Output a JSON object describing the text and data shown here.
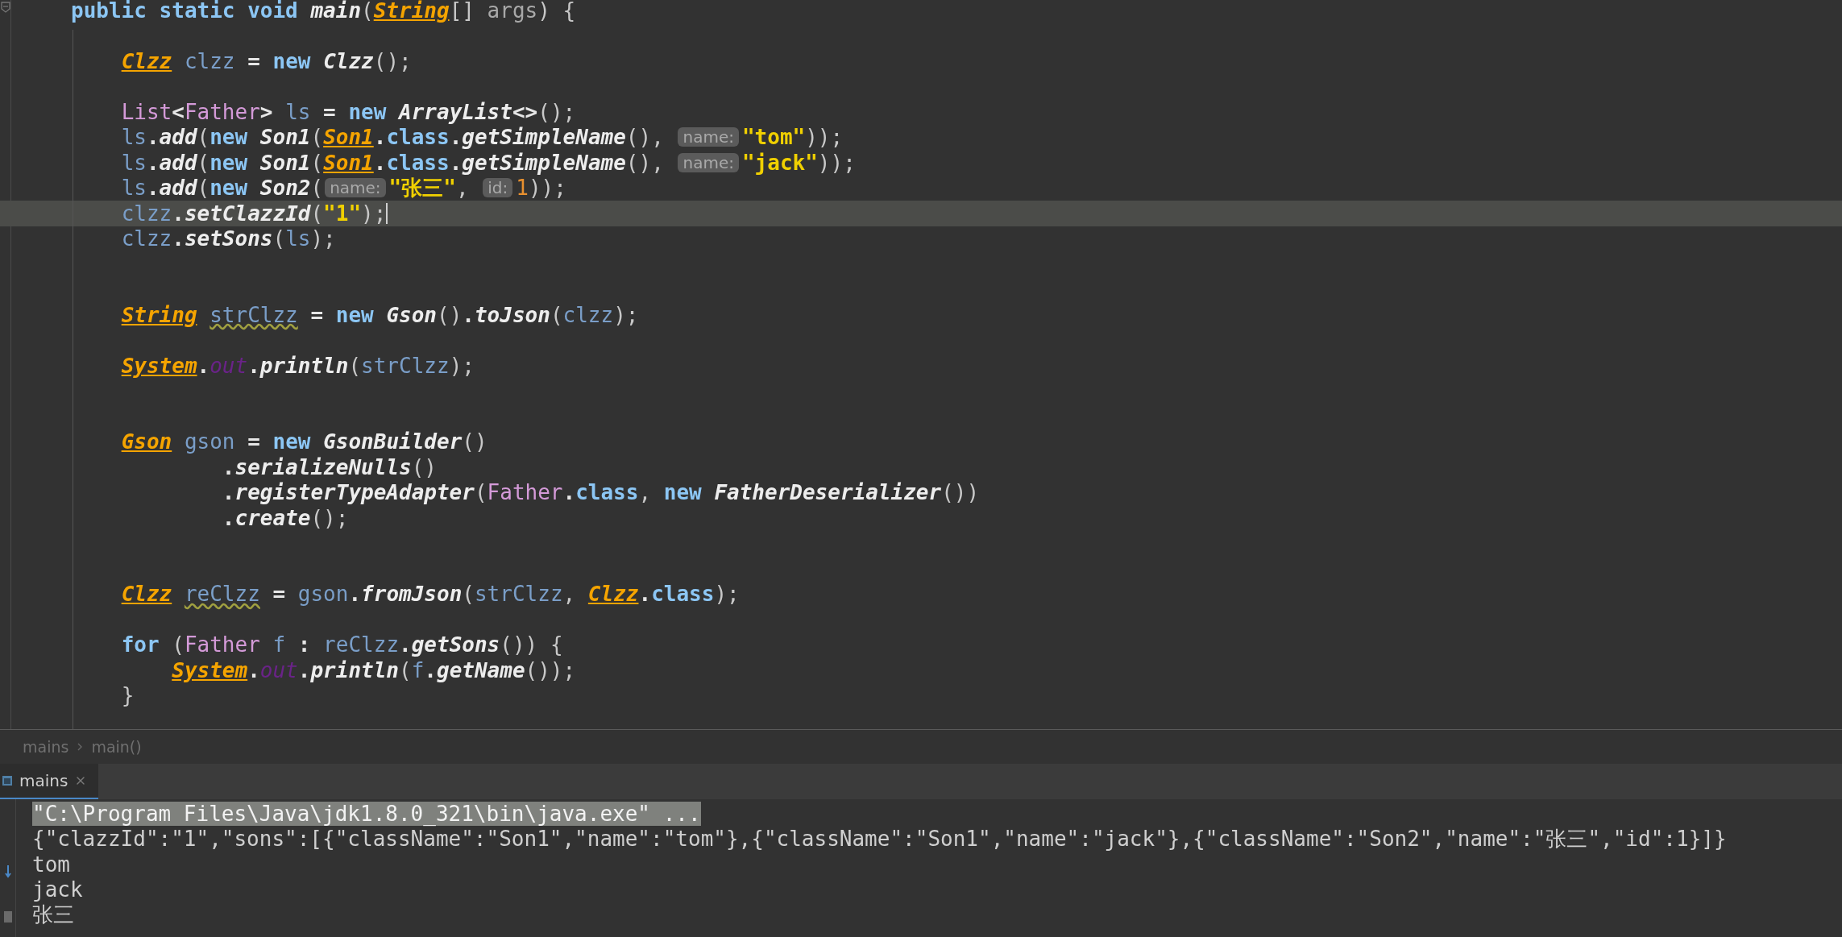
{
  "editor": {
    "lines": [
      {
        "current": false,
        "tokens": [
          {
            "kind": "kw",
            "text": "public static void "
          },
          {
            "kind": "method",
            "text": "main"
          },
          {
            "kind": "plain",
            "text": "("
          },
          {
            "kind": "type",
            "text": "String"
          },
          {
            "kind": "plain",
            "text": "[] "
          },
          {
            "kind": "param",
            "text": "args"
          },
          {
            "kind": "plain",
            "text": ") {"
          }
        ]
      },
      {
        "current": false
      },
      {
        "current": false,
        "tokens": [
          {
            "kind": "type",
            "text": "    Clzz"
          },
          {
            "kind": "var",
            "text": " clzz"
          },
          {
            "kind": "op",
            "text": " = "
          },
          {
            "kind": "kw",
            "text": "new "
          },
          {
            "kind": "method",
            "text": "Clzz"
          },
          {
            "kind": "plain",
            "text": "();"
          }
        ]
      },
      {
        "current": false
      },
      {
        "current": false,
        "tokens": [
          {
            "kind": "class",
            "text": "    List"
          },
          {
            "kind": "op",
            "text": "<"
          },
          {
            "kind": "class",
            "text": "Father"
          },
          {
            "kind": "op",
            "text": "> "
          },
          {
            "kind": "var",
            "text": "ls"
          },
          {
            "kind": "op",
            "text": " = "
          },
          {
            "kind": "kw",
            "text": "new "
          },
          {
            "kind": "method",
            "text": "ArrayList"
          },
          {
            "kind": "op",
            "text": "<>"
          },
          {
            "kind": "plain",
            "text": "();"
          }
        ]
      },
      {
        "current": false,
        "tokens": [
          {
            "kind": "var",
            "text": "    ls"
          },
          {
            "kind": "op",
            "text": "."
          },
          {
            "kind": "method",
            "text": "add"
          },
          {
            "kind": "plain",
            "text": "("
          },
          {
            "kind": "kw",
            "text": "new "
          },
          {
            "kind": "method",
            "text": "Son1"
          },
          {
            "kind": "plain",
            "text": "("
          },
          {
            "kind": "type",
            "text": "Son1"
          },
          {
            "kind": "op",
            "text": "."
          },
          {
            "kind": "kw",
            "text": "class"
          },
          {
            "kind": "op",
            "text": "."
          },
          {
            "kind": "method",
            "text": "getSimpleName"
          },
          {
            "kind": "plain",
            "text": "(), "
          },
          {
            "kind": "hint",
            "text": "name:"
          },
          {
            "kind": "string",
            "text": "\"tom\""
          },
          {
            "kind": "plain",
            "text": "));"
          }
        ]
      },
      {
        "current": false,
        "tokens": [
          {
            "kind": "var",
            "text": "    ls"
          },
          {
            "kind": "op",
            "text": "."
          },
          {
            "kind": "method",
            "text": "add"
          },
          {
            "kind": "plain",
            "text": "("
          },
          {
            "kind": "kw",
            "text": "new "
          },
          {
            "kind": "method",
            "text": "Son1"
          },
          {
            "kind": "plain",
            "text": "("
          },
          {
            "kind": "type",
            "text": "Son1"
          },
          {
            "kind": "op",
            "text": "."
          },
          {
            "kind": "kw",
            "text": "class"
          },
          {
            "kind": "op",
            "text": "."
          },
          {
            "kind": "method",
            "text": "getSimpleName"
          },
          {
            "kind": "plain",
            "text": "(), "
          },
          {
            "kind": "hint",
            "text": "name:"
          },
          {
            "kind": "string",
            "text": "\"jack\""
          },
          {
            "kind": "plain",
            "text": "));"
          }
        ]
      },
      {
        "current": false,
        "tokens": [
          {
            "kind": "var",
            "text": "    ls"
          },
          {
            "kind": "op",
            "text": "."
          },
          {
            "kind": "method",
            "text": "add"
          },
          {
            "kind": "plain",
            "text": "("
          },
          {
            "kind": "kw",
            "text": "new "
          },
          {
            "kind": "method",
            "text": "Son2"
          },
          {
            "kind": "plain",
            "text": "("
          },
          {
            "kind": "hint",
            "text": "name:"
          },
          {
            "kind": "string",
            "text": "\"张三\""
          },
          {
            "kind": "plain",
            "text": ", "
          },
          {
            "kind": "hint",
            "text": "id:"
          },
          {
            "kind": "number",
            "text": "1"
          },
          {
            "kind": "plain",
            "text": "));"
          }
        ]
      },
      {
        "current": true,
        "tokens": [
          {
            "kind": "var",
            "text": "    clzz"
          },
          {
            "kind": "op",
            "text": "."
          },
          {
            "kind": "method",
            "text": "setClazzId"
          },
          {
            "kind": "plain",
            "text": "("
          },
          {
            "kind": "string",
            "text": "\"1\""
          },
          {
            "kind": "plain",
            "text": ");"
          }
        ]
      },
      {
        "current": false,
        "tokens": [
          {
            "kind": "var",
            "text": "    clzz"
          },
          {
            "kind": "op",
            "text": "."
          },
          {
            "kind": "method",
            "text": "setSons"
          },
          {
            "kind": "plain",
            "text": "("
          },
          {
            "kind": "var",
            "text": "ls"
          },
          {
            "kind": "plain",
            "text": ");"
          }
        ]
      },
      {
        "current": false
      },
      {
        "current": false
      },
      {
        "current": false,
        "tokens": [
          {
            "kind": "type",
            "text": "    String"
          },
          {
            "kind": "var_warned",
            "text": " strClzz"
          },
          {
            "kind": "op",
            "text": " = "
          },
          {
            "kind": "kw",
            "text": "new "
          },
          {
            "kind": "method",
            "text": "Gson"
          },
          {
            "kind": "plain",
            "text": "()"
          },
          {
            "kind": "op",
            "text": "."
          },
          {
            "kind": "method",
            "text": "toJson"
          },
          {
            "kind": "plain",
            "text": "("
          },
          {
            "kind": "var",
            "text": "clzz"
          },
          {
            "kind": "plain",
            "text": ");"
          }
        ]
      },
      {
        "current": false
      },
      {
        "current": false,
        "tokens": [
          {
            "kind": "type",
            "text": "    System"
          },
          {
            "kind": "op",
            "text": "."
          },
          {
            "kind": "field",
            "text": "out"
          },
          {
            "kind": "op",
            "text": "."
          },
          {
            "kind": "method",
            "text": "println"
          },
          {
            "kind": "plain",
            "text": "("
          },
          {
            "kind": "var",
            "text": "strClzz"
          },
          {
            "kind": "plain",
            "text": ");"
          }
        ]
      },
      {
        "current": false
      },
      {
        "current": false
      },
      {
        "current": false,
        "tokens": [
          {
            "kind": "type",
            "text": "    Gson"
          },
          {
            "kind": "var",
            "text": " gson"
          },
          {
            "kind": "op",
            "text": " = "
          },
          {
            "kind": "kw",
            "text": "new "
          },
          {
            "kind": "method",
            "text": "GsonBuilder"
          },
          {
            "kind": "plain",
            "text": "()"
          }
        ]
      },
      {
        "current": false,
        "tokens": [
          {
            "kind": "op",
            "text": "            ."
          },
          {
            "kind": "method",
            "text": "serializeNulls"
          },
          {
            "kind": "plain",
            "text": "()"
          }
        ]
      },
      {
        "current": false,
        "tokens": [
          {
            "kind": "op",
            "text": "            ."
          },
          {
            "kind": "method",
            "text": "registerTypeAdapter"
          },
          {
            "kind": "plain",
            "text": "("
          },
          {
            "kind": "class",
            "text": "Father"
          },
          {
            "kind": "op",
            "text": "."
          },
          {
            "kind": "kw",
            "text": "class"
          },
          {
            "kind": "plain",
            "text": ", "
          },
          {
            "kind": "kw",
            "text": "new "
          },
          {
            "kind": "method",
            "text": "FatherDeserializer"
          },
          {
            "kind": "plain",
            "text": "())"
          }
        ]
      },
      {
        "current": false,
        "tokens": [
          {
            "kind": "op",
            "text": "            ."
          },
          {
            "kind": "method",
            "text": "create"
          },
          {
            "kind": "plain",
            "text": "();"
          }
        ]
      },
      {
        "current": false
      },
      {
        "current": false
      },
      {
        "current": false,
        "tokens": [
          {
            "kind": "type",
            "text": "    Clzz"
          },
          {
            "kind": "var_warned",
            "text": " reClzz"
          },
          {
            "kind": "op",
            "text": " = "
          },
          {
            "kind": "var",
            "text": "gson"
          },
          {
            "kind": "op",
            "text": "."
          },
          {
            "kind": "method",
            "text": "fromJson"
          },
          {
            "kind": "plain",
            "text": "("
          },
          {
            "kind": "var",
            "text": "strClzz"
          },
          {
            "kind": "plain",
            "text": ", "
          },
          {
            "kind": "type",
            "text": "Clzz"
          },
          {
            "kind": "op",
            "text": "."
          },
          {
            "kind": "kw",
            "text": "class"
          },
          {
            "kind": "plain",
            "text": ");"
          }
        ]
      },
      {
        "current": false
      },
      {
        "current": false,
        "tokens": [
          {
            "kind": "kw",
            "text": "    for "
          },
          {
            "kind": "plain",
            "text": "("
          },
          {
            "kind": "class",
            "text": "Father"
          },
          {
            "kind": "var",
            "text": " f"
          },
          {
            "kind": "op",
            "text": " : "
          },
          {
            "kind": "var",
            "text": "reClzz"
          },
          {
            "kind": "op",
            "text": "."
          },
          {
            "kind": "method",
            "text": "getSons"
          },
          {
            "kind": "plain",
            "text": "()) {"
          }
        ]
      },
      {
        "current": false,
        "tokens": [
          {
            "kind": "type",
            "text": "        System"
          },
          {
            "kind": "op",
            "text": "."
          },
          {
            "kind": "field",
            "text": "out"
          },
          {
            "kind": "op",
            "text": "."
          },
          {
            "kind": "method",
            "text": "println"
          },
          {
            "kind": "plain",
            "text": "("
          },
          {
            "kind": "var",
            "text": "f"
          },
          {
            "kind": "op",
            "text": "."
          },
          {
            "kind": "method",
            "text": "getName"
          },
          {
            "kind": "plain",
            "text": "());"
          }
        ]
      },
      {
        "current": false,
        "tokens": [
          {
            "kind": "plain",
            "text": "    }"
          }
        ]
      }
    ]
  },
  "breadcrumbs": [
    "mains",
    "main()"
  ],
  "run_panel": {
    "tabs": [
      {
        "label": "mains",
        "selected": true
      }
    ]
  },
  "console": {
    "lines": [
      {
        "kind": "command",
        "text": "\"C:\\Program Files\\Java\\jdk1.8.0_321\\bin\\java.exe\" ..."
      },
      {
        "kind": "output",
        "text": "{\"clazzId\":\"1\",\"sons\":[{\"className\":\"Son1\",\"name\":\"tom\"},{\"className\":\"Son1\",\"name\":\"jack\"},{\"className\":\"Son2\",\"name\":\"张三\",\"id\":1}]}"
      },
      {
        "kind": "output",
        "text": "tom"
      },
      {
        "kind": "output",
        "text": "jack"
      },
      {
        "kind": "output",
        "text": "张三"
      }
    ]
  }
}
